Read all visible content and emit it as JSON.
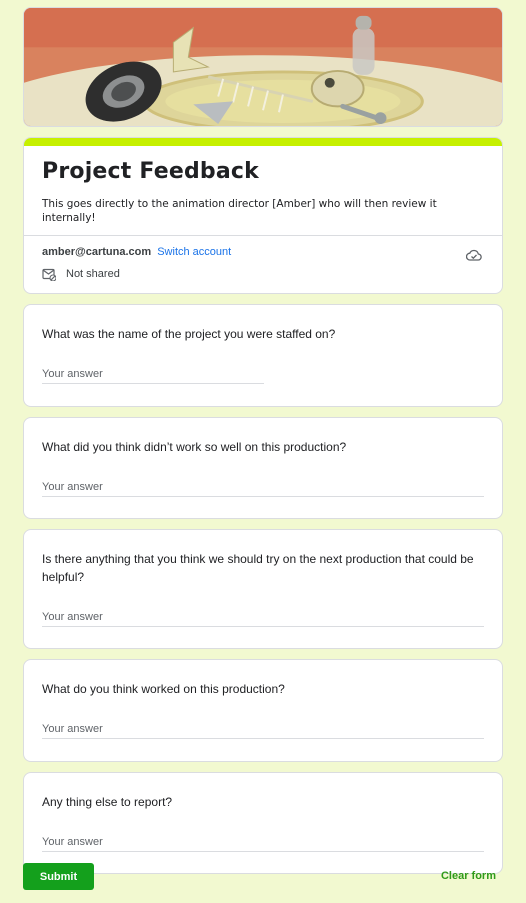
{
  "form": {
    "title": "Project Feedback",
    "description": "This goes directly to the animation director [Amber] who will then review it internally!",
    "accent_color": "#c6f000",
    "background_color": "#f2f9d0"
  },
  "account": {
    "email": "amber@cartuna.com",
    "switch_label": "Switch account",
    "shared_status": "Not shared",
    "cloud_icon": "cloud-check-icon",
    "share_icon": "not-shared-icon"
  },
  "questions": [
    {
      "text": "What was the name of the project you were staffed on?",
      "placeholder": "Your answer"
    },
    {
      "text": "What did you think didn’t work so well on this production?",
      "placeholder": "Your answer"
    },
    {
      "text": "Is there anything that you think we should try on the next production that could be helpful?",
      "placeholder": "Your answer"
    },
    {
      "text": "What do you think worked on this production?",
      "placeholder": "Your answer"
    },
    {
      "text": "Any thing else to report?",
      "placeholder": "Your answer"
    }
  ],
  "actions": {
    "submit_label": "Submit",
    "submit_color": "#14a01c",
    "clear_label": "Clear form"
  }
}
